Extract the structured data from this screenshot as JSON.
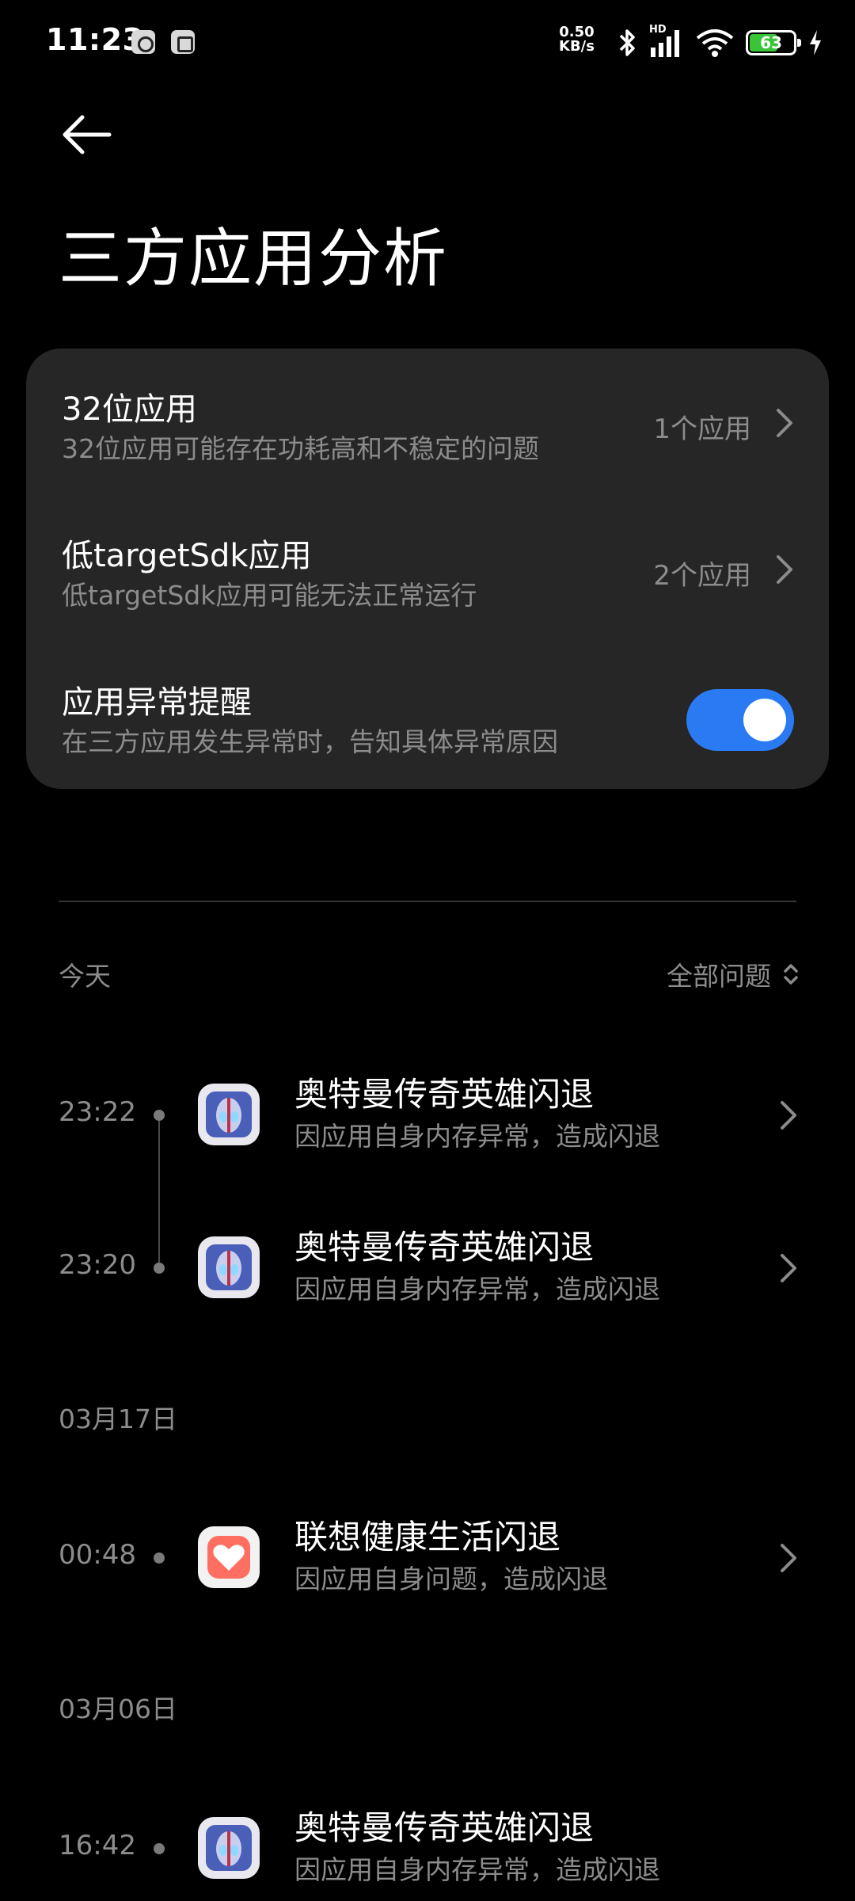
{
  "status_bar": {
    "time": "11:23",
    "net_speed_value": "0.50",
    "net_speed_unit": "KB/s",
    "network_label": "HD",
    "battery": "63"
  },
  "header": {
    "title": "三方应用分析"
  },
  "card": {
    "rows": [
      {
        "title": "32位应用",
        "subtitle": "32位应用可能存在功耗高和不稳定的问题",
        "value": "1个应用"
      },
      {
        "title": "低targetSdk应用",
        "subtitle": "低targetSdk应用可能无法正常运行",
        "value": "2个应用"
      },
      {
        "title": "应用异常提醒",
        "subtitle": "在三方应用发生异常时，告知具体异常原因",
        "toggle_on": true
      }
    ]
  },
  "list": {
    "filter_label": "全部问题",
    "sections": [
      {
        "label": "今天",
        "entries": [
          {
            "time": "23:22",
            "title": "奥特曼传奇英雄闪退",
            "subtitle": "因应用自身内存异常，造成闪退",
            "icon": "ultraman-app-icon"
          },
          {
            "time": "23:20",
            "title": "奥特曼传奇英雄闪退",
            "subtitle": "因应用自身内存异常，造成闪退",
            "icon": "ultraman-app-icon"
          }
        ]
      },
      {
        "label": "03月17日",
        "entries": [
          {
            "time": "00:48",
            "title": "联想健康生活闪退",
            "subtitle": "因应用自身问题，造成闪退",
            "icon": "health-app-icon"
          }
        ]
      },
      {
        "label": "03月06日",
        "entries": [
          {
            "time": "16:42",
            "title": "奥特曼传奇英雄闪退",
            "subtitle": "因应用自身内存异常，造成闪退",
            "icon": "ultraman-app-icon"
          }
        ]
      }
    ]
  },
  "colors": {
    "background": "#000000",
    "card": "#262626",
    "accent": "#2a7af3",
    "secondary_text": "#8c8c8c"
  }
}
